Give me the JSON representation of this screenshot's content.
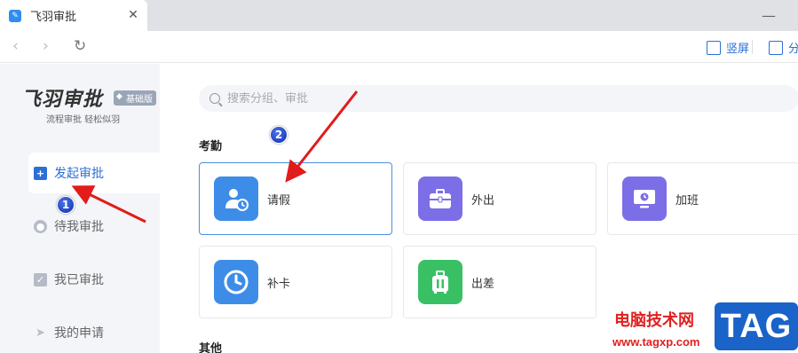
{
  "browser": {
    "tab_title": "飞羽审批",
    "close_glyph": "✕",
    "minimize_glyph": "—",
    "back_glyph": "‹",
    "forward_glyph": "›",
    "reload_glyph": "↻",
    "portrait_label": "竖屏",
    "share_label": "分"
  },
  "sidebar": {
    "brand": "飞羽审批",
    "badge": "基础版",
    "badge_icon": "gem-icon",
    "slogan": "流程审批 轻松似羽",
    "items": [
      {
        "label": "发起审批",
        "icon": "plus-square-icon",
        "glyph": "+",
        "active": true
      },
      {
        "label": "待我审批",
        "icon": "person-icon",
        "glyph": "●",
        "active": false
      },
      {
        "label": "我已审批",
        "icon": "check-square-icon",
        "glyph": "✓",
        "active": false
      },
      {
        "label": "我的申请",
        "icon": "send-icon",
        "glyph": "➤",
        "active": false
      }
    ]
  },
  "search": {
    "placeholder": "搜索分组、审批"
  },
  "sections": [
    {
      "title": "考勤"
    },
    {
      "title": "其他"
    }
  ],
  "cards": [
    {
      "label": "请假",
      "icon": "leave-person-clock-icon",
      "color": "#3d8de8",
      "selected": true
    },
    {
      "label": "外出",
      "icon": "briefcase-icon",
      "color": "#7b6ee6",
      "selected": false
    },
    {
      "label": "加班",
      "icon": "monitor-clock-icon",
      "color": "#7b6ee6",
      "selected": false
    },
    {
      "label": "补卡",
      "icon": "clock-icon",
      "color": "#3d8de8",
      "selected": false
    },
    {
      "label": "出差",
      "icon": "luggage-icon",
      "color": "#39c064",
      "selected": false
    }
  ],
  "annotations": {
    "marker1": "1",
    "marker2": "2",
    "arrow_color": "#e21b1b"
  },
  "watermark": {
    "text": "电脑技术网",
    "url": "www.tagxp.com",
    "tag": "TAG"
  }
}
